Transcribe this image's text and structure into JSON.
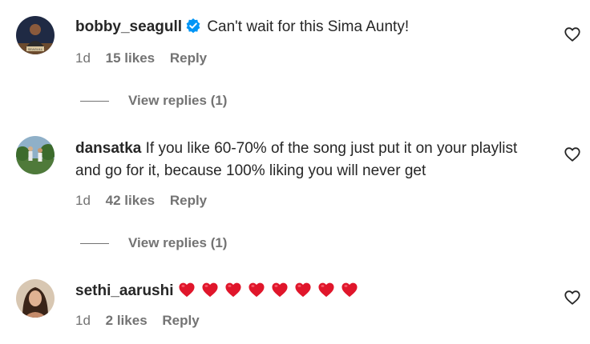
{
  "comments": [
    {
      "username": "bobby_seagull",
      "verified": true,
      "text": "Can't wait for this Sima Aunty!",
      "time": "1d",
      "likes": "15 likes",
      "reply": "Reply",
      "view_replies": "View replies (1)",
      "avatar_caption": "SEAGULL"
    },
    {
      "username": "dansatka",
      "verified": false,
      "text": "If you like 60-70% of the song just put it on your playlist and go for it, because 100% liking you will never get",
      "time": "1d",
      "likes": "42 likes",
      "reply": "Reply",
      "view_replies": "View replies (1)"
    },
    {
      "username": "sethi_aarushi",
      "verified": false,
      "text": "",
      "emoji": "red-heart",
      "emoji_count": 8,
      "time": "1d",
      "likes": "2 likes",
      "reply": "Reply"
    }
  ],
  "icons": {
    "like": "heart-outline-icon",
    "verified": "verified-badge-icon"
  },
  "colors": {
    "text": "#262626",
    "secondary": "#737373",
    "verified": "#0095f6",
    "heart_emoji": "#e0162b"
  }
}
